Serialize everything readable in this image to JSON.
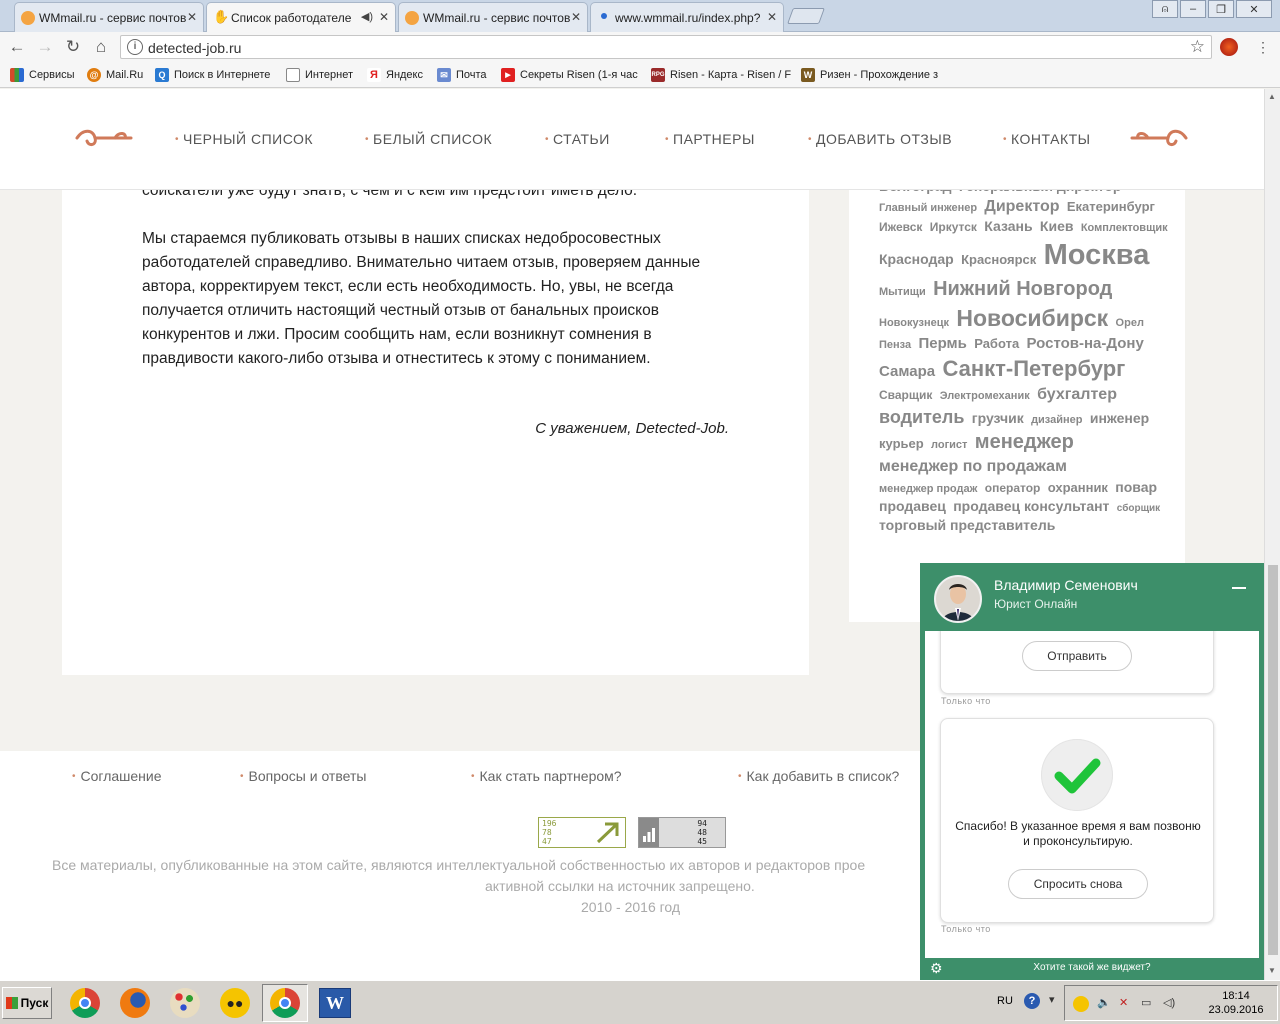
{
  "browser": {
    "tabs": [
      {
        "title": "WMmail.ru - сервис почтов",
        "favicon": "#f4a442",
        "active": false
      },
      {
        "title": "Список работодателей",
        "favicon": "hand",
        "active": true
      },
      {
        "title": "WMmail.ru - сервис почтов",
        "favicon": "#f4a442",
        "active": false
      },
      {
        "title": "www.wmmail.ru/index.php?",
        "favicon": "#2a6ad2",
        "active": false
      }
    ],
    "url": "detected-job.ru",
    "bookmarks": [
      {
        "label": "Сервисы",
        "icon": "apps-icon",
        "color": "#d34a2a"
      },
      {
        "label": "Mail.Ru",
        "icon": "mailru-icon",
        "color": "#e07d10"
      },
      {
        "label": "Поиск в Интернете",
        "icon": "search-icon",
        "color": "#2a7ad2"
      },
      {
        "label": "Интернет",
        "icon": "page-icon",
        "color": "#ffffff"
      },
      {
        "label": "Яндекс",
        "icon": "yandex-icon",
        "color": "#e02020"
      },
      {
        "label": "Почта",
        "icon": "mail-icon",
        "color": "#6a8ad0"
      },
      {
        "label": "Секреты Risen (1-я час",
        "icon": "youtube-icon",
        "color": "#e02020"
      },
      {
        "label": "Risen - Карта - Risen / F",
        "icon": "rpg-icon",
        "color": "#9a2a2a"
      },
      {
        "label": "Ризен - Прохождение з",
        "icon": "w-icon",
        "color": "#7a5a20"
      }
    ]
  },
  "site": {
    "nav": [
      "ЧЕРНЫЙ СПИСОК",
      "БЕЛЫЙ СПИСОК",
      "СТАТЬИ",
      "ПАРТНЕРЫ",
      "ДОБАВИТЬ ОТЗЫВ",
      "КОНТАКТЫ"
    ],
    "partial_line": "соискатели уже будут знать, с чем и с кем им предстоит иметь дело.",
    "paragraph": "Мы стараемся публиковать отзывы в наших списках недобросовестных работодателей справедливо. Внимательно читаем отзыв, проверяем данные автора, корректируем текст, если есть необходимость. Но, увы, не всегда получается отличить настоящий честный отзыв от банальных происков конкурентов и лжи. Просим сообщить нам, если возникнут сомнения в правдивости какого-либо отзыва и отнеститесь к этому с пониманием.",
    "signature": "С уважением, Detected-Job.",
    "tags": [
      {
        "t": "Волгоград",
        "s": 14
      },
      {
        "t": "Генеральный директор",
        "s": 14
      },
      {
        "t": "Главный инженер",
        "s": 11
      },
      {
        "t": "Директор",
        "s": 16
      },
      {
        "t": "Екатеринбург",
        "s": 13
      },
      {
        "t": "Ижевск",
        "s": 12
      },
      {
        "t": "Иркутск",
        "s": 12
      },
      {
        "t": "Казань",
        "s": 14
      },
      {
        "t": "Киев",
        "s": 14
      },
      {
        "t": "Комплектовщик",
        "s": 11
      },
      {
        "t": "Краснодар",
        "s": 14
      },
      {
        "t": "Красноярск",
        "s": 13
      },
      {
        "t": "Москва",
        "s": 29
      },
      {
        "t": "Мытищи",
        "s": 11
      },
      {
        "t": "Нижний Новгород",
        "s": 20
      },
      {
        "t": "Новокузнецк",
        "s": 11
      },
      {
        "t": "Новосибирск",
        "s": 23
      },
      {
        "t": "Орел",
        "s": 11
      },
      {
        "t": "Пенза",
        "s": 11
      },
      {
        "t": "Пермь",
        "s": 15
      },
      {
        "t": "Работа",
        "s": 13
      },
      {
        "t": "Ростов-на-Дону",
        "s": 15
      },
      {
        "t": "Самара",
        "s": 15
      },
      {
        "t": "Санкт-Петербург",
        "s": 22
      },
      {
        "t": "Сварщик",
        "s": 12
      },
      {
        "t": "Электромеханик",
        "s": 11
      },
      {
        "t": "бухгалтер",
        "s": 16
      },
      {
        "t": "водитель",
        "s": 18
      },
      {
        "t": "грузчик",
        "s": 14
      },
      {
        "t": "дизайнер",
        "s": 11
      },
      {
        "t": "инженер",
        "s": 14
      },
      {
        "t": "курьер",
        "s": 13
      },
      {
        "t": "логист",
        "s": 11
      },
      {
        "t": "менеджер",
        "s": 20
      },
      {
        "t": "менеджер по продажам",
        "s": 16
      },
      {
        "t": "менеджер продаж",
        "s": 11
      },
      {
        "t": "оператор",
        "s": 12
      },
      {
        "t": "охранник",
        "s": 13
      },
      {
        "t": "повар",
        "s": 14
      },
      {
        "t": "продавец",
        "s": 14
      },
      {
        "t": "продавец консультант",
        "s": 14
      },
      {
        "t": "сборщик",
        "s": 10
      },
      {
        "t": "торговый представитель",
        "s": 14
      }
    ],
    "footer_links": [
      "Соглашение",
      "Вопросы и ответы",
      "Как стать партнером?",
      "Как добавить в список?"
    ],
    "counter1": [
      "196",
      "78",
      "47"
    ],
    "counter2": [
      "94",
      "48",
      "45"
    ],
    "copyright_line1": "Все материалы, опубликованные на этом сайте, являются интеллектуальной собственностью их авторов и редакторов прое",
    "copyright_line2": "активной ссылки на источник запрещено.",
    "copyright_years": "2010 - 2016 год"
  },
  "chat": {
    "agent_name": "Владимир Семенович",
    "agent_role": "Юрист Онлайн",
    "send_label": "Отправить",
    "timestamp": "Только что",
    "thanks_text": "Спасибо! В указанное время я вам позвоню и проконсультирую.",
    "ask_again_label": "Спросить снова",
    "footer_promo": "Хотите такой же виджет?",
    "accent": "#3d8f6a"
  },
  "taskbar": {
    "start_label": "Пуск",
    "lang": "RU",
    "time": "18:14",
    "date": "23.09.2016"
  }
}
